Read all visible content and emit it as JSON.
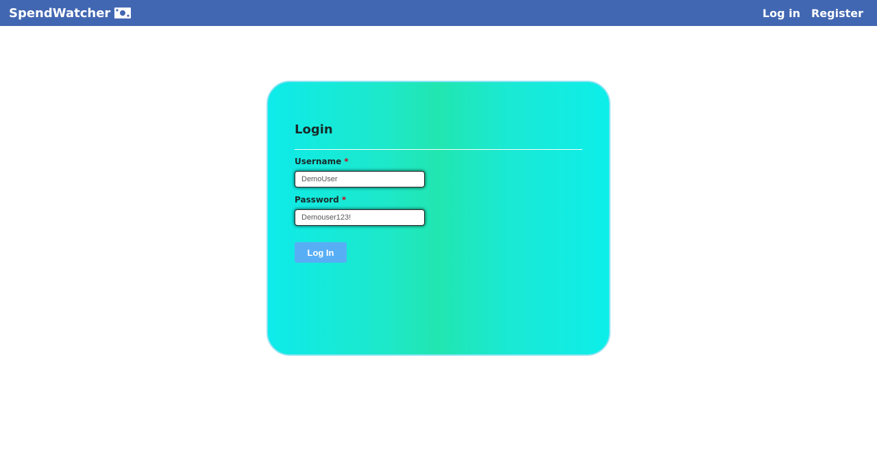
{
  "navbar": {
    "brand": "SpendWatcher",
    "brand_icon": "money-bill-icon",
    "links": {
      "login": "Log in",
      "register": "Register"
    },
    "bg_color": "#4267b2"
  },
  "login_form": {
    "title": "Login",
    "username": {
      "label": "Username",
      "required_marker": "*",
      "value": "DemoUser"
    },
    "password": {
      "label": "Password",
      "required_marker": "*",
      "value": "Demouser123!"
    },
    "submit_label": "Log In",
    "button_color": "#58aef5"
  }
}
